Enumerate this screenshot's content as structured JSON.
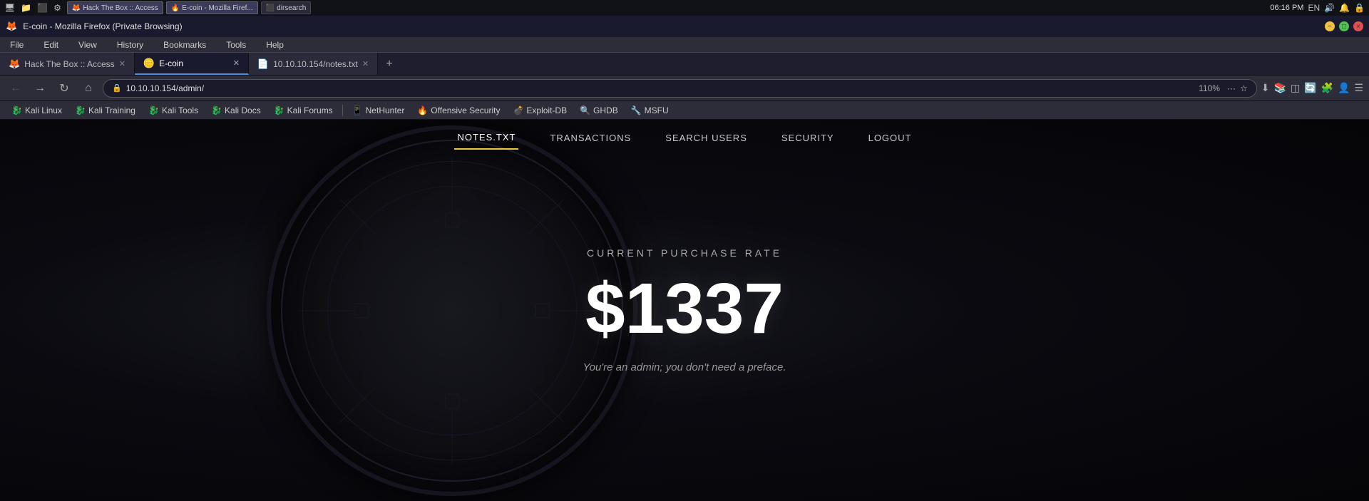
{
  "system_bar": {
    "clock": "06:16 PM",
    "lang": "EN"
  },
  "title_bar": {
    "title": "E-coin - Mozilla Firefox (Private Browsing)",
    "minimize": "−",
    "maximize": "□",
    "close": "×"
  },
  "menu": {
    "items": [
      "File",
      "Edit",
      "View",
      "History",
      "Bookmarks",
      "Tools",
      "Help"
    ]
  },
  "tabs": [
    {
      "id": "tab1",
      "label": "Hack The Box :: Access",
      "favicon": "🦊",
      "active": false
    },
    {
      "id": "tab2",
      "label": "E-coin",
      "favicon": "🪙",
      "active": true
    },
    {
      "id": "tab3",
      "label": "10.10.10.154/notes.txt",
      "favicon": "📄",
      "active": false
    }
  ],
  "nav": {
    "url": "10.10.10.154/admin/",
    "zoom": "110%",
    "back_btn": "←",
    "forward_btn": "→",
    "reload_btn": "↻",
    "home_btn": "⌂"
  },
  "bookmarks": [
    {
      "label": "Kali Linux",
      "icon": "🐉"
    },
    {
      "label": "Kali Training",
      "icon": "🐉"
    },
    {
      "label": "Kali Tools",
      "icon": "🐉"
    },
    {
      "label": "Kali Docs",
      "icon": "🐉"
    },
    {
      "label": "Kali Forums",
      "icon": "🐉"
    },
    {
      "label": "NetHunter",
      "icon": "📱"
    },
    {
      "label": "Offensive Security",
      "icon": "🔥"
    },
    {
      "label": "Exploit-DB",
      "icon": "💣"
    },
    {
      "label": "GHDB",
      "icon": "🔍"
    },
    {
      "label": "MSFU",
      "icon": "🔧"
    }
  ],
  "website": {
    "nav_items": [
      "NOTES.TXT",
      "TRANSACTIONS",
      "SEARCH USERS",
      "SECURITY",
      "LOGOUT"
    ],
    "active_nav": "NOTES.TXT",
    "purchase_rate_label": "CURRENT PURCHASE RATE",
    "purchase_rate_value": "$1337",
    "admin_message": "You're an admin; you don't need a preface."
  }
}
